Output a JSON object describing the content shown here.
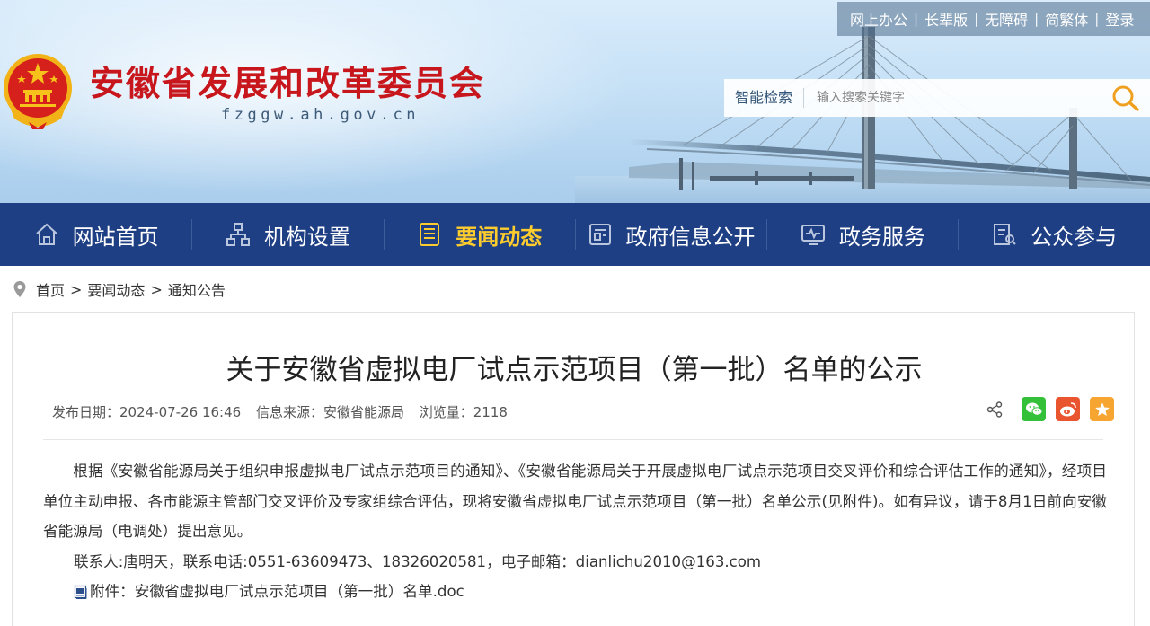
{
  "header": {
    "site_title": "安徽省发展和改革委员会",
    "site_domain": "fzggw.ah.gov.cn",
    "emblem_icon": "national-emblem-icon",
    "top_links": [
      "网上办公",
      "长辈版",
      "无障碍",
      "简繁体",
      "登录"
    ],
    "search": {
      "label": "智能检索",
      "placeholder": "输入搜索关键字",
      "button_icon": "search-icon"
    }
  },
  "nav": {
    "items": [
      {
        "label": "网站首页",
        "icon": "home-icon"
      },
      {
        "label": "机构设置",
        "icon": "org-chart-icon"
      },
      {
        "label": "要闻动态",
        "icon": "news-icon"
      },
      {
        "label": "政府信息公开",
        "icon": "info-disclosure-icon"
      },
      {
        "label": "政务服务",
        "icon": "service-icon"
      },
      {
        "label": "公众参与",
        "icon": "participation-icon"
      }
    ],
    "active_index": 2,
    "background_color": "#1e3f84",
    "active_color": "#ffcc2e"
  },
  "breadcrumb": {
    "items": [
      "首页",
      "要闻动态",
      "通知公告"
    ],
    "separator": ">"
  },
  "article": {
    "title": "关于安徽省虚拟电厂试点示范项目（第一批）名单的公示",
    "meta": {
      "date": "发布日期：2024-07-26 16:46",
      "source": "信息来源：安徽省能源局",
      "views": "浏览量：2118"
    },
    "share_icons": [
      "share-icon",
      "wechat-icon",
      "weibo-icon",
      "favorite-icon"
    ],
    "paragraph": "根据《安徽省能源局关于组织申报虚拟电厂试点示范项目的通知》、《安徽省能源局关于开展虚拟电厂试点示范项目交叉评价和综合评估工作的通知》，经项目单位主动申报、各市能源主管部门交叉评价及专家组综合评估，现将安徽省虚拟电厂试点示范项目（第一批）名单公示(见附件)。如有异议，请于8月1日前向安徽省能源局（电调处）提出意见。",
    "contact": "联系人:唐明天，联系电话:0551-63609473、18326020581，电子邮箱：dianlichu2010@163.com",
    "attachment": "附件：安徽省虚拟电厂试点示范项目（第一批）名单.doc"
  }
}
